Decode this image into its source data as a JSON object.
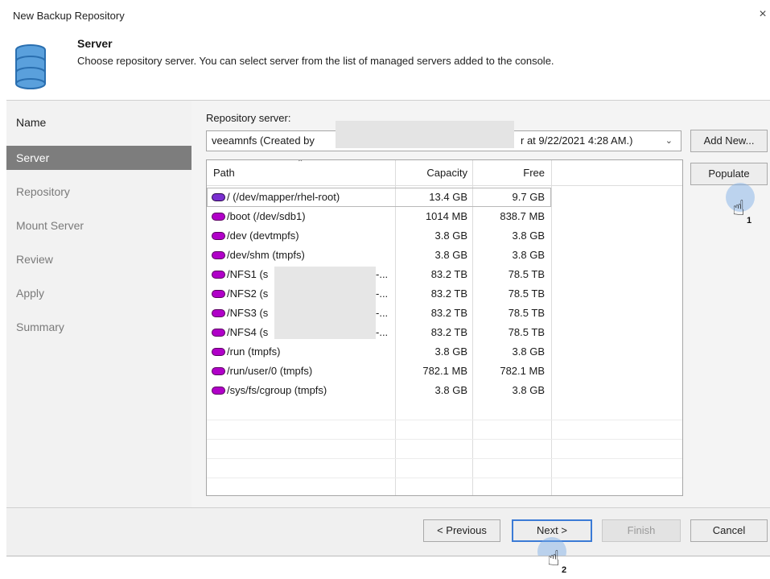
{
  "window": {
    "title": "New Backup Repository",
    "close_glyph": "×"
  },
  "header": {
    "icon": "database-icon",
    "title": "Server",
    "description": "Choose repository server. You can select server from the list of managed servers added to the console."
  },
  "nav": {
    "items": [
      {
        "label": "Name",
        "state": "done"
      },
      {
        "label": "Server",
        "state": "active"
      },
      {
        "label": "Repository",
        "state": "pending"
      },
      {
        "label": "Mount Server",
        "state": "pending"
      },
      {
        "label": "Review",
        "state": "pending"
      },
      {
        "label": "Apply",
        "state": "pending"
      },
      {
        "label": "Summary",
        "state": "pending"
      }
    ]
  },
  "repository_server": {
    "label": "Repository server:",
    "selected_left": "veeamnfs (Created by",
    "selected_right": "r at 9/22/2021 4:28 AM.)",
    "add_new_label": "Add New...",
    "populate_label": "Populate"
  },
  "table": {
    "columns": [
      "Path",
      "Capacity",
      "Free"
    ],
    "rows": [
      {
        "path": "/ (/dev/mapper/rhel-root)",
        "capacity": "13.4 GB",
        "free": "9.7 GB"
      },
      {
        "path": "/boot (/dev/sdb1)",
        "capacity": "1014 MB",
        "free": "838.7 MB"
      },
      {
        "path": "/dev (devtmpfs)",
        "capacity": "3.8 GB",
        "free": "3.8 GB"
      },
      {
        "path": "/dev/shm (tmpfs)",
        "capacity": "3.8 GB",
        "free": "3.8 GB"
      },
      {
        "path": "/NFS1 (s",
        "path_suffix": "-...",
        "capacity": "83.2 TB",
        "free": "78.5 TB"
      },
      {
        "path": "/NFS2 (s",
        "path_suffix": "-...",
        "capacity": "83.2 TB",
        "free": "78.5 TB"
      },
      {
        "path": "/NFS3 (s",
        "path_suffix": "-...",
        "capacity": "83.2 TB",
        "free": "78.5 TB"
      },
      {
        "path": "/NFS4 (s",
        "path_suffix": "-...",
        "capacity": "83.2 TB",
        "free": "78.5 TB"
      },
      {
        "path": "/run (tmpfs)",
        "capacity": "3.8 GB",
        "free": "3.8 GB"
      },
      {
        "path": "/run/user/0 (tmpfs)",
        "capacity": "782.1 MB",
        "free": "782.1 MB"
      },
      {
        "path": "/sys/fs/cgroup (tmpfs)",
        "capacity": "3.8 GB",
        "free": "3.8 GB"
      }
    ]
  },
  "footer": {
    "previous_label": "< Previous",
    "next_label": "Next >",
    "finish_label": "Finish",
    "cancel_label": "Cancel"
  },
  "annotations": {
    "step1": "1",
    "step2": "2"
  },
  "colors": {
    "disk_icon": "#b000c8",
    "nav_active": "#7d7d7d",
    "primary_border": "#3b7bd6"
  }
}
